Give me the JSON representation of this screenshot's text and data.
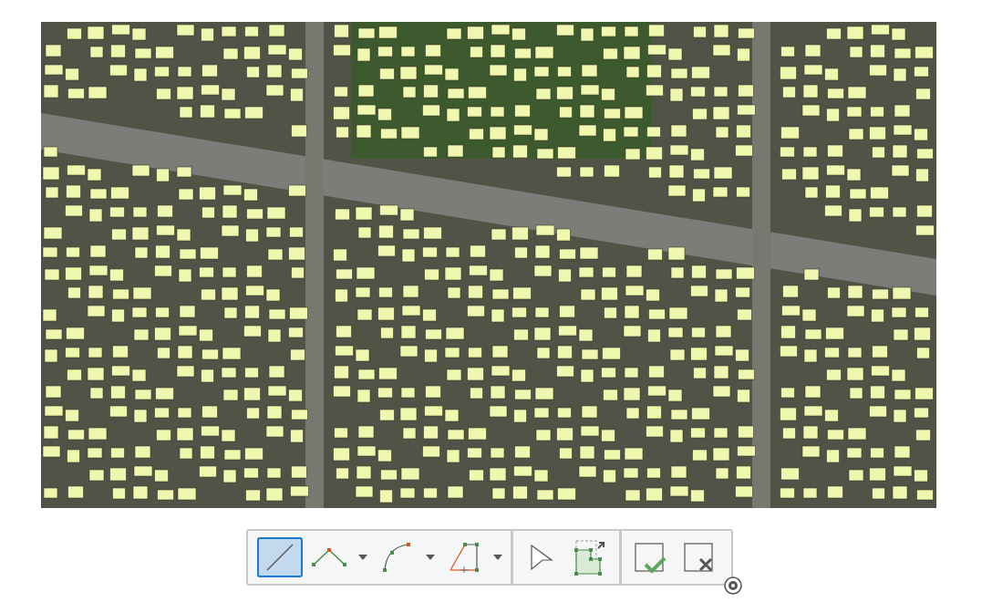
{
  "toolbar": {
    "groups": [
      {
        "tools": [
          {
            "kind": "line",
            "selected": true
          },
          {
            "kind": "polyline",
            "selected": false,
            "dropdown": true
          },
          {
            "kind": "arc",
            "selected": false,
            "dropdown": true
          },
          {
            "kind": "trace",
            "selected": false,
            "dropdown": true
          }
        ]
      },
      {
        "tools": [
          {
            "kind": "select",
            "selected": false
          },
          {
            "kind": "transform",
            "selected": false
          }
        ]
      },
      {
        "tools": [
          {
            "kind": "finish",
            "selected": false
          },
          {
            "kind": "cancel",
            "selected": false
          }
        ]
      }
    ]
  }
}
